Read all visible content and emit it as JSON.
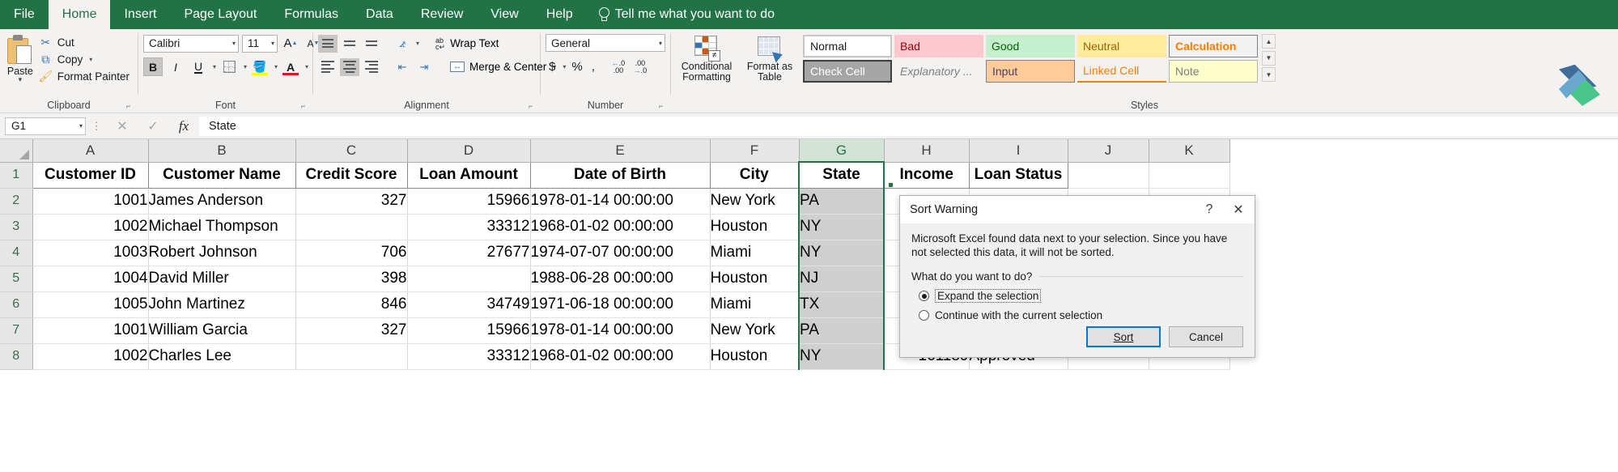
{
  "ribbon": {
    "tabs": [
      {
        "label": "File",
        "active": false
      },
      {
        "label": "Home",
        "active": true
      },
      {
        "label": "Insert",
        "active": false
      },
      {
        "label": "Page Layout",
        "active": false
      },
      {
        "label": "Formulas",
        "active": false
      },
      {
        "label": "Data",
        "active": false
      },
      {
        "label": "Review",
        "active": false
      },
      {
        "label": "View",
        "active": false
      },
      {
        "label": "Help",
        "active": false
      }
    ],
    "tellme": "Tell me what you want to do",
    "groups": {
      "clipboard": {
        "label": "Clipboard",
        "paste": "Paste",
        "cut": "Cut",
        "copy": "Copy",
        "format_painter": "Format Painter"
      },
      "font": {
        "label": "Font",
        "font_name": "Calibri",
        "font_size": "11",
        "bold": "B",
        "italic": "I",
        "underline": "U",
        "grow": "A",
        "shrink": "A"
      },
      "alignment": {
        "label": "Alignment",
        "wrap_text": "Wrap Text",
        "merge_center": "Merge & Center"
      },
      "number": {
        "label": "Number",
        "format": "General",
        "currency": "$",
        "percent": "%",
        "comma": ",",
        "increase_decimal": ".00",
        "decrease_decimal": ".00"
      },
      "styles": {
        "label": "Styles",
        "conditional_formatting": "Conditional Formatting",
        "format_as_table": "Format as Table",
        "cell_styles": [
          {
            "label": "Normal",
            "kind": "normal"
          },
          {
            "label": "Bad",
            "kind": "bad"
          },
          {
            "label": "Good",
            "kind": "good"
          },
          {
            "label": "Neutral",
            "kind": "neutral"
          },
          {
            "label": "Calculation",
            "kind": "calc"
          },
          {
            "label": "Check Cell",
            "kind": "check"
          },
          {
            "label": "Explanatory ...",
            "kind": "expl"
          },
          {
            "label": "Input",
            "kind": "input"
          },
          {
            "label": "Linked Cell",
            "kind": "linked"
          },
          {
            "label": "Note",
            "kind": "note"
          }
        ]
      }
    }
  },
  "formula_bar": {
    "name_box": "G1",
    "cancel": "✕",
    "enter": "✓",
    "fx": "fx",
    "content": "State"
  },
  "sheet": {
    "columns": [
      "A",
      "B",
      "C",
      "D",
      "E",
      "F",
      "G",
      "H",
      "I",
      "J",
      "K"
    ],
    "selected_column": "G",
    "row_numbers": [
      "1",
      "2",
      "3",
      "4",
      "5",
      "6",
      "7",
      "8"
    ],
    "headers": [
      "Customer ID",
      "Customer Name",
      "Credit Score",
      "Loan Amount",
      "Date of Birth",
      "City",
      "State",
      "Income",
      "Loan Status",
      "",
      ""
    ],
    "rows": [
      [
        "1001",
        "James Anderson",
        "327",
        "15966",
        "1978-01-14 00:00:00",
        "New York",
        "PA",
        "",
        "",
        "",
        ""
      ],
      [
        "1002",
        "Michael Thompson",
        "",
        "33312",
        "1968-01-02 00:00:00",
        "Houston",
        "NY",
        "",
        "",
        "",
        ""
      ],
      [
        "1003",
        "Robert Johnson",
        "706",
        "27677",
        "1974-07-07 00:00:00",
        "Miami",
        "NY",
        "",
        "",
        "",
        ""
      ],
      [
        "1004",
        "David Miller",
        "398",
        "",
        "1988-06-28 00:00:00",
        "Houston",
        "NJ",
        "",
        "",
        "",
        ""
      ],
      [
        "1005",
        "John Martinez",
        "846",
        "34749",
        "1971-06-18 00:00:00",
        "Miami",
        "TX",
        "",
        "",
        "",
        ""
      ],
      [
        "1001",
        "William Garcia",
        "327",
        "15966",
        "1978-01-14 00:00:00",
        "New York",
        "PA",
        "",
        "",
        "",
        ""
      ],
      [
        "1002",
        "Charles Lee",
        "",
        "33312",
        "1968-01-02 00:00:00",
        "Houston",
        "NY",
        "161189",
        "Approved",
        "",
        ""
      ]
    ]
  },
  "dialog": {
    "title": "Sort Warning",
    "help": "?",
    "close": "✕",
    "message": "Microsoft Excel found data next to your selection.  Since you have not selected this data, it will not be sorted.",
    "question": "What do you want to do?",
    "options": [
      {
        "label": "Expand the selection",
        "checked": true
      },
      {
        "label": "Continue with the current selection",
        "checked": false
      }
    ],
    "ok_button": "Sort",
    "cancel_button": "Cancel"
  },
  "colors": {
    "ribbon_green": "#217346",
    "selection_green": "#217346",
    "dialog_accent": "#0078d7"
  }
}
